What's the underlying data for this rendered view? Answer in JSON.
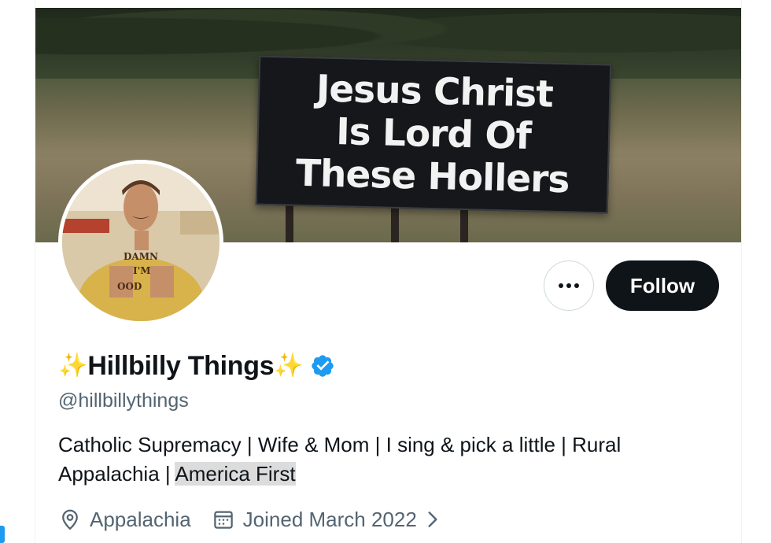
{
  "banner": {
    "billboard_lines": [
      "Jesus Christ",
      "Is Lord Of",
      "These Hollers"
    ]
  },
  "avatar": {
    "shirt_text": [
      "DAMN",
      "I'M",
      "OOD"
    ]
  },
  "actions": {
    "more_label": "More",
    "follow_label": "Follow"
  },
  "profile": {
    "sparkle": "✨",
    "display_name": "Hillbilly Things",
    "handle": "@hillbillythings",
    "bio_main": "Catholic Supremacy | Wife & Mom | I sing & pick a little | Rural Appalachia | ",
    "bio_highlight": "America First",
    "location": "Appalachia",
    "joined": "Joined March 2022"
  },
  "colors": {
    "accent": "#1d9bf0",
    "text": "#0f1419",
    "secondary_text": "#536471",
    "verified_badge": "#1d9bf0"
  },
  "icons": {
    "verified": "verified-badge-icon",
    "location": "location-pin-icon",
    "joined": "calendar-icon",
    "chevron": "chevron-right-icon"
  }
}
